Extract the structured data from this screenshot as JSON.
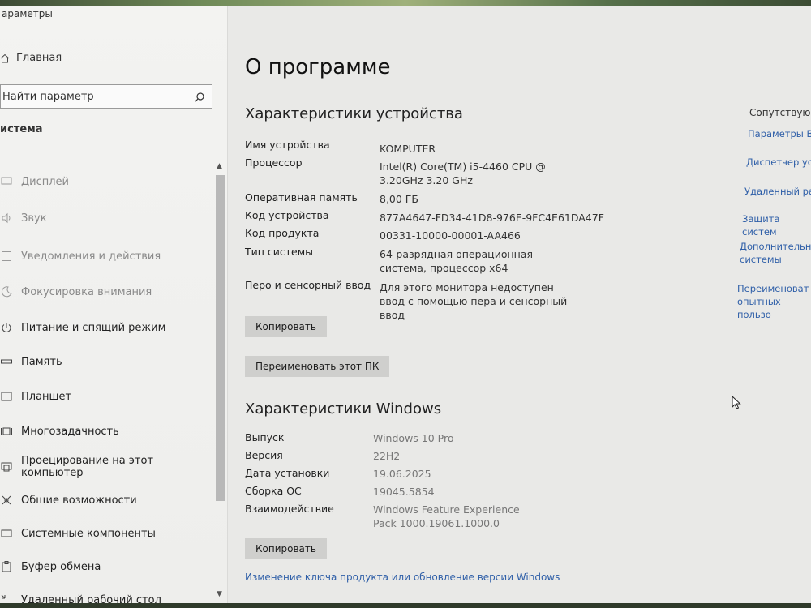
{
  "window": {
    "title": "араметры"
  },
  "sidebar": {
    "home_label": "Главная",
    "search_placeholder": "Найти параметр",
    "section": "истема",
    "items": [
      {
        "label": "Дисплей",
        "icon": "display-icon"
      },
      {
        "label": "Звук",
        "icon": "sound-icon"
      },
      {
        "label": "Уведомления и действия",
        "icon": "notifications-icon"
      },
      {
        "label": "Фокусировка внимания",
        "icon": "focus-assist-icon"
      },
      {
        "label": "Питание и спящий режим",
        "icon": "power-icon"
      },
      {
        "label": "Память",
        "icon": "storage-icon"
      },
      {
        "label": "Планшет",
        "icon": "tablet-icon"
      },
      {
        "label": "Многозадачность",
        "icon": "multitasking-icon"
      },
      {
        "label": "Проецирование на этот компьютер",
        "icon": "projecting-icon"
      },
      {
        "label": "Общие возможности",
        "icon": "shared-experiences-icon"
      },
      {
        "label": "Системные компоненты",
        "icon": "system-components-icon"
      },
      {
        "label": "Буфер обмена",
        "icon": "clipboard-icon"
      },
      {
        "label": "Удаленный рабочий стол",
        "icon": "remote-desktop-icon"
      }
    ]
  },
  "main": {
    "title": "О программе",
    "device_section": {
      "heading": "Характеристики устройства",
      "rows": [
        {
          "label": "Имя устройства",
          "value": "KOMPUTER"
        },
        {
          "label": "Процессор",
          "value": "Intel(R) Core(TM) i5-4460 CPU @ 3.20GHz 3.20 GHz"
        },
        {
          "label": "Оперативная память",
          "value": "8,00 ГБ"
        },
        {
          "label": "Код устройства",
          "value": "877A4647-FD34-41D8-976E-9FC4E61DA47F"
        },
        {
          "label": "Код продукта",
          "value": "00331-10000-00001-AA466"
        },
        {
          "label": "Тип системы",
          "value": "64-разрядная операционная система, процессор x64"
        },
        {
          "label": "Перо и сенсорный ввод",
          "value": "Для этого монитора недоступен ввод с помощью пера и сенсорный ввод"
        }
      ],
      "copy_label": "Копировать",
      "rename_label": "Переименовать этот ПК"
    },
    "windows_section": {
      "heading": "Характеристики Windows",
      "rows": [
        {
          "label": "Выпуск",
          "value": "Windows 10 Pro"
        },
        {
          "label": "Версия",
          "value": "22H2"
        },
        {
          "label": "Дата установки",
          "value": "19.06.2025"
        },
        {
          "label": "Сборка ОС",
          "value": "19045.5854"
        },
        {
          "label": "Взаимодействие",
          "value": "Windows Feature Experience Pack 1000.19061.1000.0"
        }
      ],
      "copy_label": "Копировать",
      "product_key_link": "Изменение ключа продукта или обновление версии Windows"
    }
  },
  "related": {
    "heading": "Сопутствующ",
    "links": [
      "Параметры Bi",
      "Диспетчер ус",
      "Удаленный раб",
      "Защита систем",
      "Дополнительн системы",
      "Переименоват опытных пользо"
    ]
  },
  "colors": {
    "link": "#2f5fa8",
    "button": "#cfcfcd",
    "sidebar_bg": "#f2f2f0",
    "main_bg": "#e9e9e7"
  }
}
